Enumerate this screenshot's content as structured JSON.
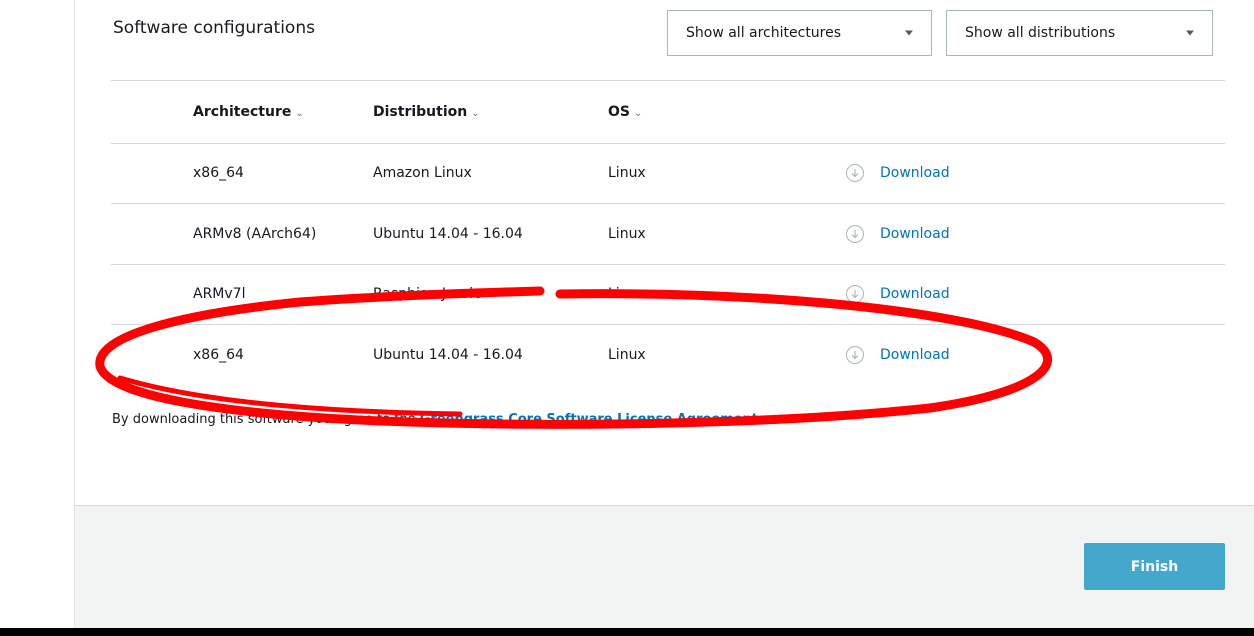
{
  "section": {
    "title": "Software configurations"
  },
  "filters": {
    "architecture": {
      "selected": "Show all architectures"
    },
    "distribution": {
      "selected": "Show all distributions"
    }
  },
  "table": {
    "columns": [
      "Architecture",
      "Distribution",
      "OS"
    ],
    "rows": [
      {
        "architecture": "x86_64",
        "distribution": "Amazon Linux",
        "os": "Linux",
        "action": "Download"
      },
      {
        "architecture": "ARMv8 (AArch64)",
        "distribution": "Ubuntu 14.04 - 16.04",
        "os": "Linux",
        "action": "Download"
      },
      {
        "architecture": "ARMv7l",
        "distribution": "Raspbian Jessie",
        "os": "Linux",
        "action": "Download"
      },
      {
        "architecture": "x86_64",
        "distribution": "Ubuntu 14.04 - 16.04",
        "os": "Linux",
        "action": "Download"
      }
    ]
  },
  "agreement": {
    "prefix": "By downloading this software you agree to the ",
    "link": "Greengrass Core Software License Agreement",
    "suffix": "."
  },
  "footer": {
    "finish_label": "Finish"
  },
  "colors": {
    "link": "#0073bb",
    "primary_button": "#44a8cc",
    "annotation_ellipse": "#ff0000",
    "footer_background": "#f2f3f3"
  },
  "icons": {
    "dropdown": "caret-down-icon",
    "sort": "chevron-down-icon",
    "download": "download-circle-icon"
  }
}
